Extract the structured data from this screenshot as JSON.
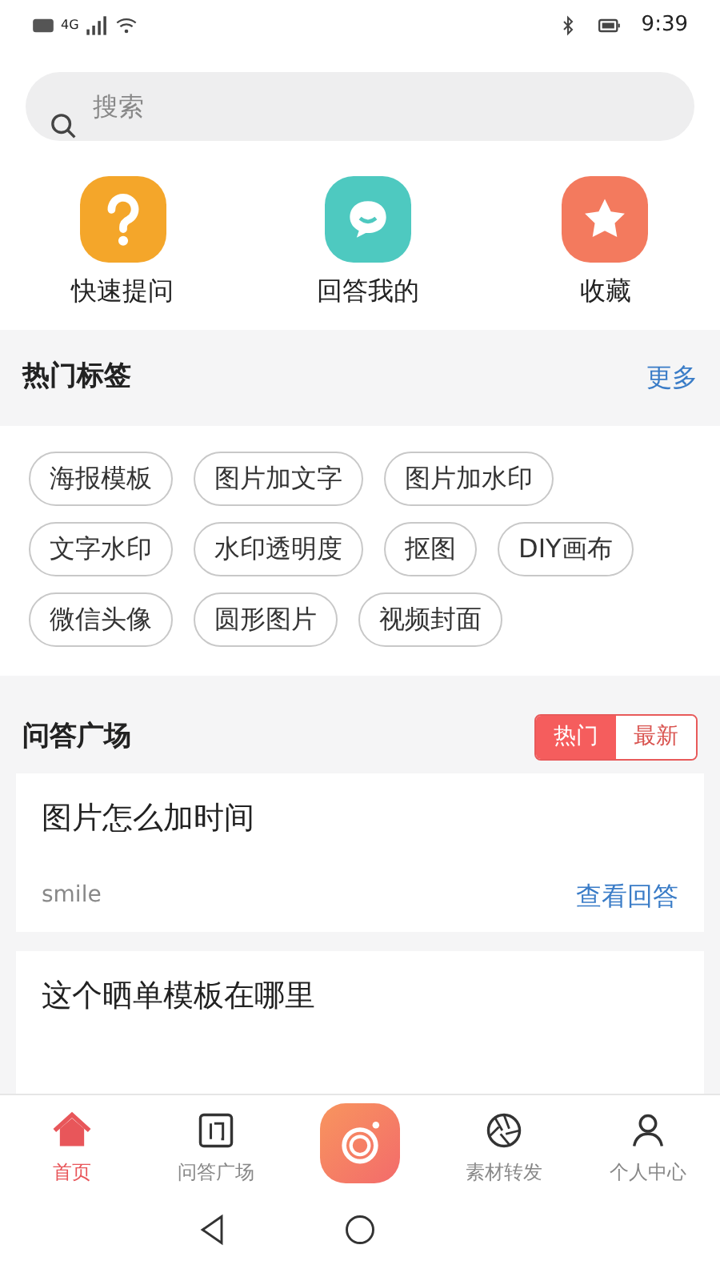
{
  "status_bar": {
    "network": "4G",
    "time": "9:39"
  },
  "search": {
    "placeholder": "搜索"
  },
  "shortcuts": [
    {
      "label": "快速提问",
      "kind": "question",
      "color": "#f4a62a"
    },
    {
      "label": "回答我的",
      "kind": "chat",
      "color": "#4ec9c0"
    },
    {
      "label": "收藏",
      "kind": "star",
      "color": "#f37a5e"
    }
  ],
  "hot_tags": {
    "title": "热门标签",
    "more": "更多",
    "tags": [
      "海报模板",
      "图片加文字",
      "图片加水印",
      "文字水印",
      "水印透明度",
      "抠图",
      "DIY画布",
      "微信头像",
      "圆形图片",
      "视频封面"
    ]
  },
  "qa": {
    "title": "问答广场",
    "toggle": [
      {
        "label": "热门",
        "selected": true
      },
      {
        "label": "最新",
        "selected": false
      }
    ],
    "questions": [
      {
        "title": "图片怎么加时间",
        "author": "smile",
        "link": "查看回答"
      },
      {
        "title": "这个晒单模板在哪里"
      }
    ]
  },
  "bottom_nav": [
    {
      "label": "首页",
      "kind": "home",
      "selected": true
    },
    {
      "label": "问答广场",
      "kind": "qa",
      "selected": false
    },
    {
      "kind": "camera"
    },
    {
      "label": "素材转发",
      "kind": "aperture",
      "selected": false
    },
    {
      "label": "个人中心",
      "kind": "person",
      "selected": false
    }
  ]
}
